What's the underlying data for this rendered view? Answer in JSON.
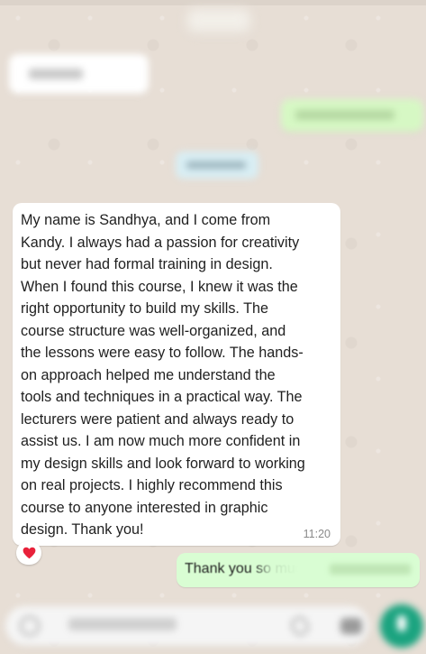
{
  "chat": {
    "message": {
      "text": "My name is Sandhya, and I come from\nKandy. I always had a passion for creativity\nbut never had formal training in design.\nWhen I found this course, I knew it was the\nright opportunity to build my skills. The\ncourse structure was well-organized, and\nthe lessons were easy to follow. The hands-\non approach helped me understand the\ntools and techniques in a practical way. The\nlecturers were patient and always ready to\nassist us. I am now much more confident in\nmy design skills and look forward to working\non real projects. I highly recommend this\ncourse to anyone interested in graphic\ndesign. Thank you!",
      "time": "11:20",
      "reaction": "❤️"
    },
    "reply": {
      "text": "Thank you so much"
    }
  },
  "colors": {
    "chat_background": "#e7ded5",
    "incoming_bubble": "#ffffff",
    "outgoing_bubble": "#d9fdd3",
    "send_button": "#1aa37f",
    "reaction_heart": "#e8213a"
  },
  "icons": {
    "reaction": "heart-icon",
    "emoji": "emoji-icon",
    "attach": "paperclip-icon",
    "camera": "camera-icon",
    "send": "mic-icon"
  }
}
